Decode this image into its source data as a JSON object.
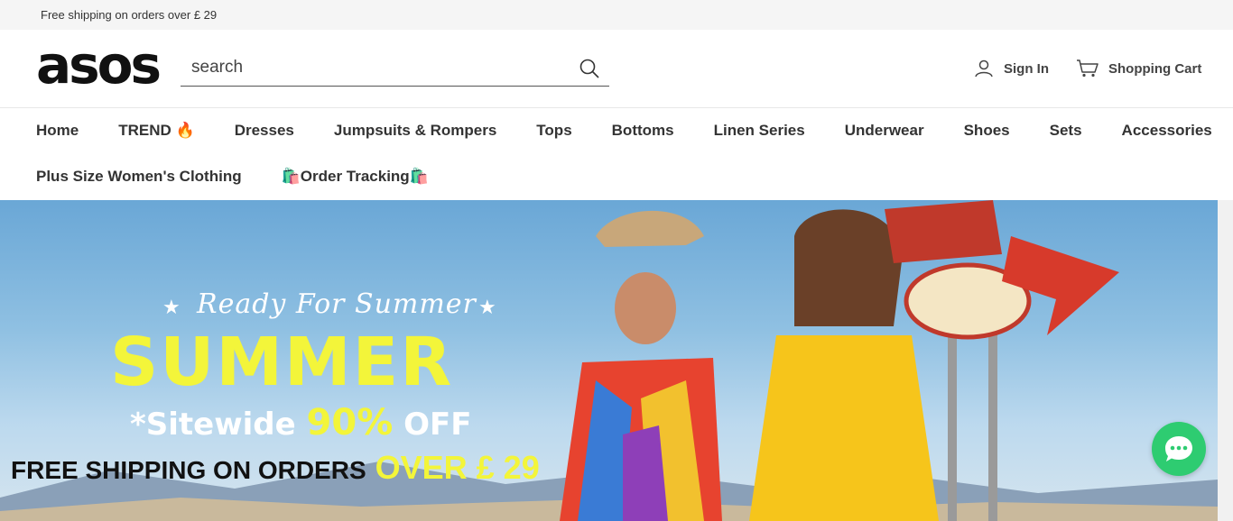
{
  "topbar": {
    "shipping_text": "Free shipping on orders over  £ 29"
  },
  "header": {
    "logo_text": "asos",
    "search": {
      "placeholder": "search",
      "value": ""
    },
    "sign_in_label": "Sign In",
    "cart_label": "Shopping Cart"
  },
  "nav": {
    "row1": [
      {
        "label": "Home"
      },
      {
        "label": "TREND 🔥"
      },
      {
        "label": "Dresses"
      },
      {
        "label": "Jumpsuits & Rompers"
      },
      {
        "label": "Tops"
      },
      {
        "label": "Bottoms"
      },
      {
        "label": "Linen Series"
      },
      {
        "label": "Underwear"
      },
      {
        "label": "Shoes"
      },
      {
        "label": "Sets"
      },
      {
        "label": "Accessories"
      }
    ],
    "row2": [
      {
        "label": "Plus Size Women's Clothing"
      },
      {
        "label": "🛍️Order Tracking🛍️"
      }
    ]
  },
  "hero": {
    "tagline": "Ready For Summer",
    "headline": "SUMMER",
    "sitewide_prefix": "*Sitewide",
    "sitewide_discount": "90%",
    "sitewide_suffix": "OFF",
    "shipping_prefix": "FREE SHIPPING ON ORDERS",
    "shipping_amount": "OVER  £ 29"
  },
  "icons": {
    "search": "search-icon",
    "user": "user-icon",
    "cart": "cart-icon",
    "chat": "chat-icon"
  },
  "colors": {
    "accent_yellow": "#f3f53a",
    "chat_green": "#2ecc71",
    "topbar_bg": "#f5f5f5"
  }
}
